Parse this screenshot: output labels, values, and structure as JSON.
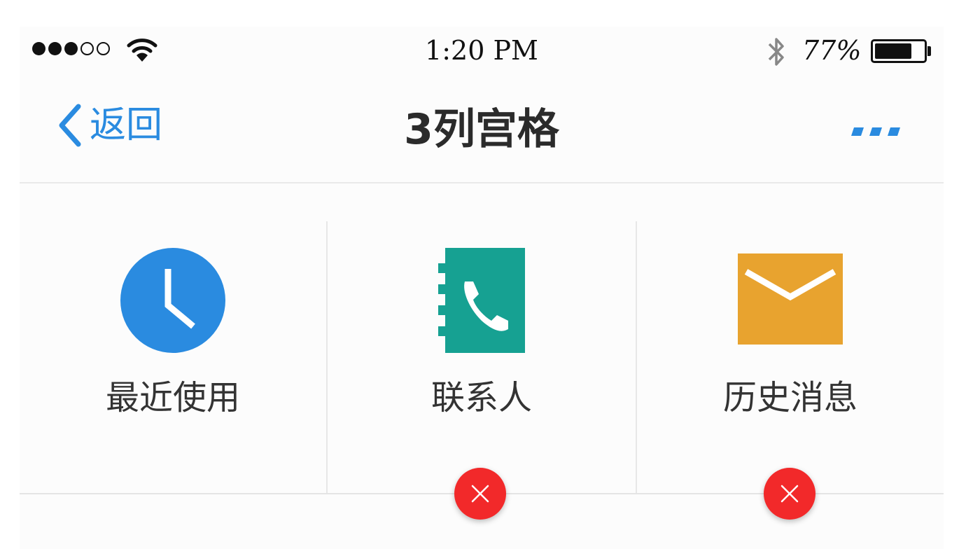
{
  "status_bar": {
    "signal_full": 3,
    "signal_total": 5,
    "time": "1:20 PM",
    "battery_percent_label": "77%",
    "battery_level": 0.77
  },
  "nav": {
    "back_label": "返回",
    "title": "3列宫格",
    "accent_color": "#2a8be0"
  },
  "grid": {
    "items": [
      {
        "label": "最近使用",
        "icon": "clock-icon",
        "color": "#2a8be0",
        "deletable": false
      },
      {
        "label": "联系人",
        "icon": "contacts-book-icon",
        "color": "#16a192",
        "deletable": true
      },
      {
        "label": "历史消息",
        "icon": "envelope-icon",
        "color": "#e8a32f",
        "deletable": true
      }
    ]
  },
  "delete_badge_color": "#f2292a"
}
